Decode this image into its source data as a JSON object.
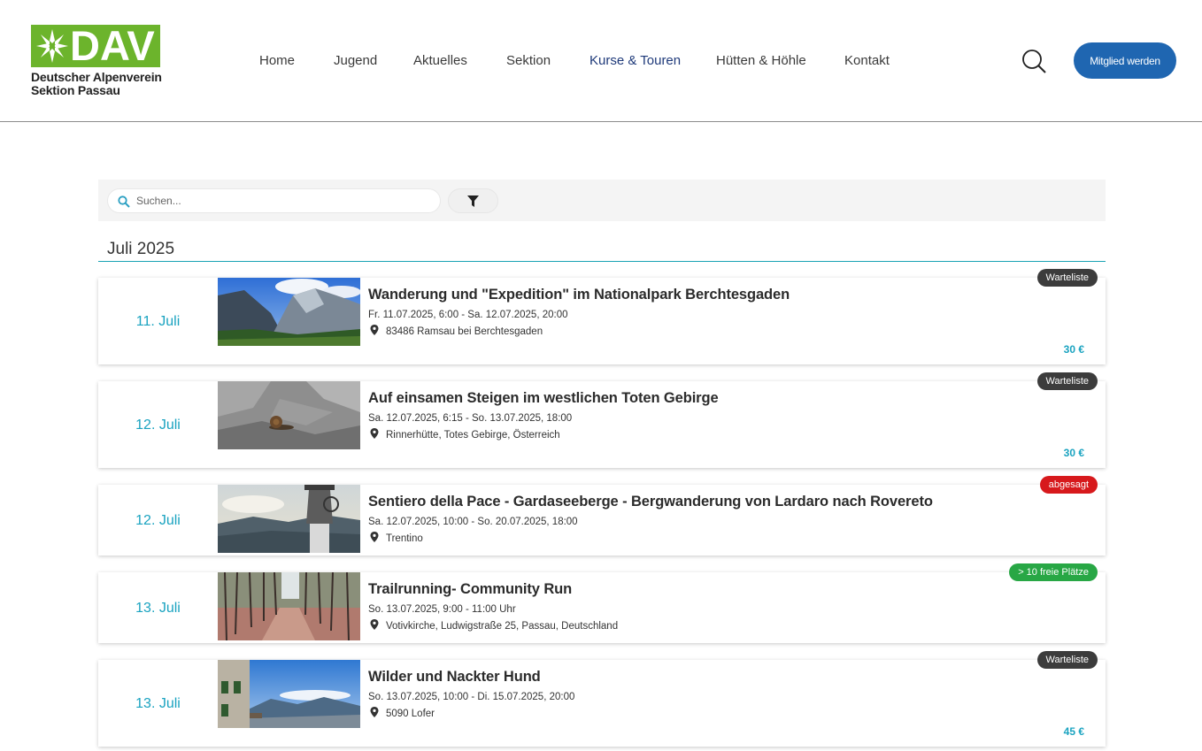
{
  "brand": {
    "logo_text": "DAV",
    "line1": "Deutscher Alpenverein",
    "line2": "Sektion Passau",
    "color": "#6cb42c"
  },
  "nav": {
    "items": [
      {
        "label": "Home",
        "active": false
      },
      {
        "label": "Jugend",
        "active": false
      },
      {
        "label": "Aktuelles",
        "active": false
      },
      {
        "label": "Sektion",
        "active": false
      },
      {
        "label": "Kurse & Touren",
        "active": true
      },
      {
        "label": "Hütten & Höhle",
        "active": false
      },
      {
        "label": "Kontakt",
        "active": false
      }
    ]
  },
  "header": {
    "member_button": "Mitglied werden",
    "search_icon": "search-icon",
    "accent": "#1f66b1"
  },
  "filter": {
    "search_placeholder": "Suchen...",
    "filter_icon": "funnel-icon"
  },
  "month_heading": "Juli 2025",
  "events": [
    {
      "date": "11. Juli",
      "title": "Wanderung und \"Expedition\" im Nationalpark Berchtesgaden",
      "when": "Fr. 11.07.2025, 6:00 - Sa. 12.07.2025, 20:00",
      "where": "83486 Ramsau bei Berchtesgaden",
      "badge": "Warteliste",
      "badge_color": "#3c3c3c",
      "price": "30 €",
      "image": "mountain-valley-photo"
    },
    {
      "date": "12. Juli",
      "title": "Auf einsamen Steigen im westlichen Toten Gebirge",
      "when": "Sa. 12.07.2025, 6:15 - So. 13.07.2025, 18:00",
      "where": "Rinnerhütte, Totes Gebirge, Österreich",
      "badge": "Warteliste",
      "badge_color": "#3c3c3c",
      "price": "30 €",
      "image": "snail-on-rock-photo"
    },
    {
      "date": "12. Juli",
      "title": "Sentiero della Pace - Gardaseeberge - Bergwanderung von Lardaro nach Rovereto",
      "when": "Sa. 12.07.2025, 10:00 - So. 20.07.2025, 18:00",
      "where": "Trentino",
      "badge": "abgesagt",
      "badge_color": "#d7191c",
      "price": "",
      "image": "peace-bell-photo"
    },
    {
      "date": "13. Juli",
      "title": "Trailrunning- Community Run",
      "when": "So. 13.07.2025, 9:00 - 11:00 Uhr",
      "where": "Votivkirche, Ludwigstraße 25, Passau, Deutschland",
      "badge": "> 10 freie Plätze",
      "badge_color": "#28a745",
      "price": "",
      "image": "forest-trail-photo"
    },
    {
      "date": "13. Juli",
      "title": "Wilder und Nackter Hund",
      "when": "So. 13.07.2025, 10:00 - Di. 15.07.2025, 20:00",
      "where": "5090 Lofer",
      "badge": "Warteliste",
      "badge_color": "#3c3c3c",
      "price": "45 €",
      "image": "alpine-hut-view-photo"
    }
  ]
}
